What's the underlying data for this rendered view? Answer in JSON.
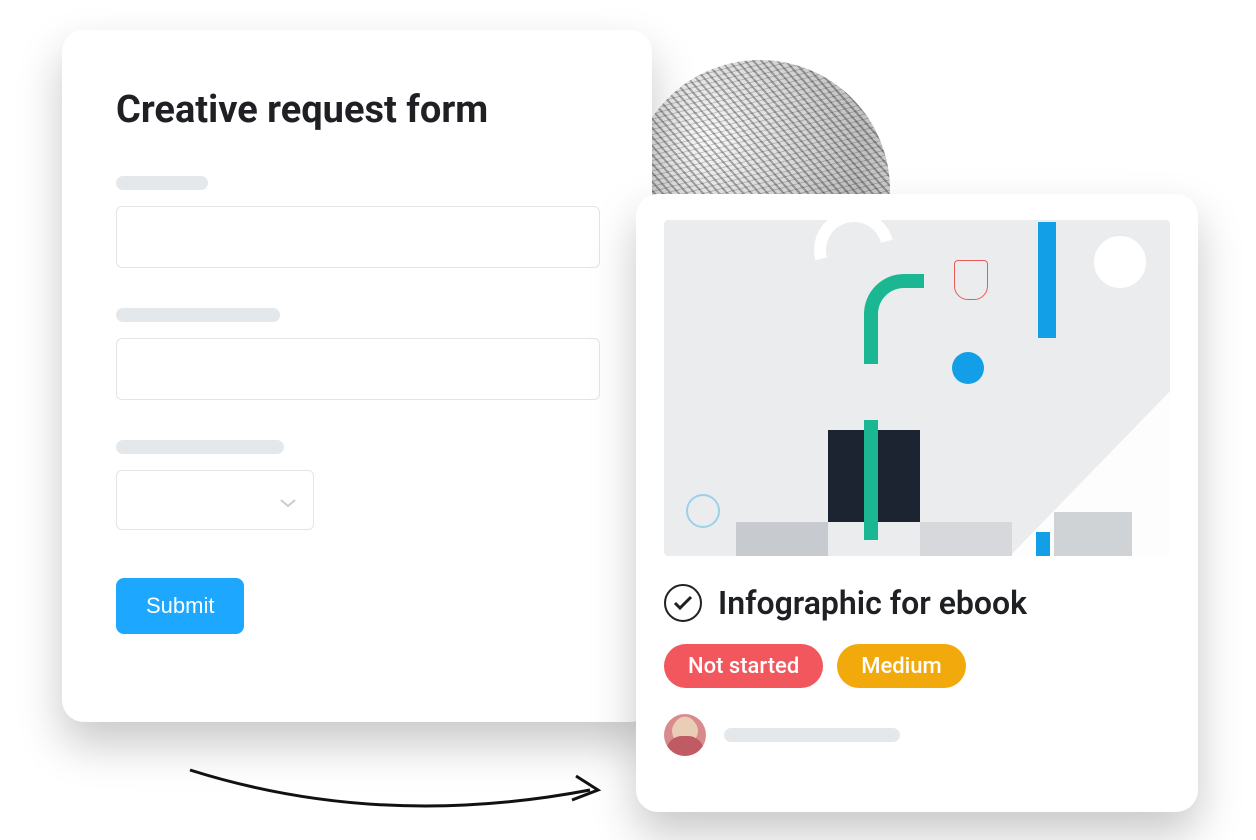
{
  "form": {
    "title": "Creative request form",
    "submit_label": "Submit"
  },
  "task": {
    "title": "Infographic for ebook",
    "status_label": "Not started",
    "priority_label": "Medium"
  },
  "colors": {
    "primary_blue": "#1DA7FF",
    "status_red": "#F2575D",
    "priority_orange": "#F2A90C",
    "accent_teal": "#1BB793"
  }
}
